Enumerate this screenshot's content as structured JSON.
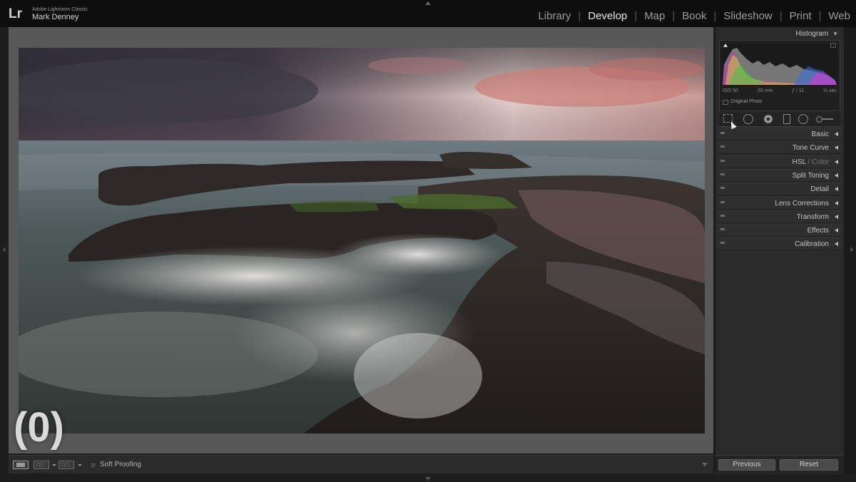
{
  "app": {
    "logo": "Lr",
    "product": "Adobe Lightroom Classic",
    "user": "Mark Denney"
  },
  "modules": [
    "Library",
    "Develop",
    "Map",
    "Book",
    "Slideshow",
    "Print",
    "Web"
  ],
  "active_module": "Develop",
  "image": {
    "overlay_number": "(0)",
    "subject": "seascape-rocks-sunset"
  },
  "toolbar": {
    "soft_proofing_label": "Soft Proofing",
    "soft_proofing_checked": false
  },
  "histogram": {
    "header": "Histogram",
    "iso": "ISO 50",
    "focal": "20 mm",
    "aperture": "ƒ / 11",
    "shutter": "½ sec",
    "original_photo_label": "Original Photo"
  },
  "tools": [
    "crop-overlay",
    "spot-removal",
    "red-eye",
    "graduated-filter",
    "radial-filter",
    "adjustment-brush"
  ],
  "sections": [
    {
      "label": "Basic"
    },
    {
      "label": "Tone Curve"
    },
    {
      "label": "HSL",
      "suffix": " / Color"
    },
    {
      "label": "Split Toning"
    },
    {
      "label": "Detail"
    },
    {
      "label": "Lens Corrections"
    },
    {
      "label": "Transform"
    },
    {
      "label": "Effects"
    },
    {
      "label": "Calibration"
    }
  ],
  "buttons": {
    "previous": "Previous",
    "reset": "Reset"
  },
  "colors": {
    "panel": "#2a2a2a",
    "canvas": "#585858",
    "topbar": "#0e0e0e"
  }
}
